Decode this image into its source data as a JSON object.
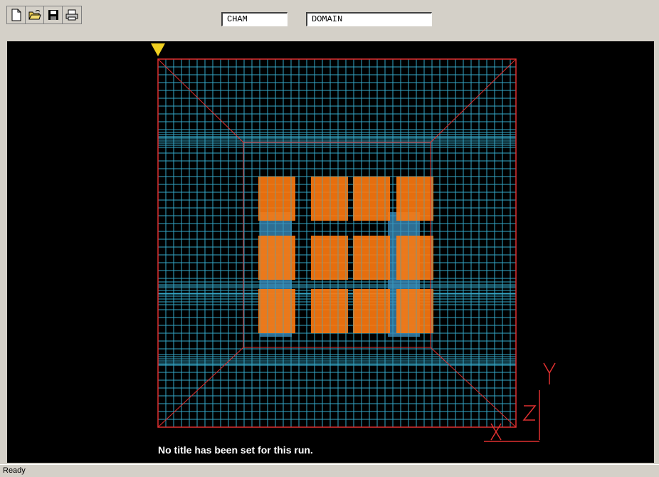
{
  "toolbar": {
    "buttons": [
      {
        "name": "new-file-icon"
      },
      {
        "name": "open-folder-icon"
      },
      {
        "name": "save-icon"
      },
      {
        "name": "print-icon"
      }
    ],
    "field1": "CHAM",
    "field2": "DOMAIN"
  },
  "viewport": {
    "run_title": "No title has been set for this run.",
    "axis_labels": {
      "x": "X",
      "y": "Y",
      "z": "Z"
    },
    "colors": {
      "background": "#000000",
      "domain_outline": "#e03030",
      "grid": "#35a8c8",
      "objects": "#ff7a10",
      "object_shadow": "#3a8ab8",
      "marker": "#f0d020"
    }
  },
  "status": {
    "text": "Ready"
  }
}
